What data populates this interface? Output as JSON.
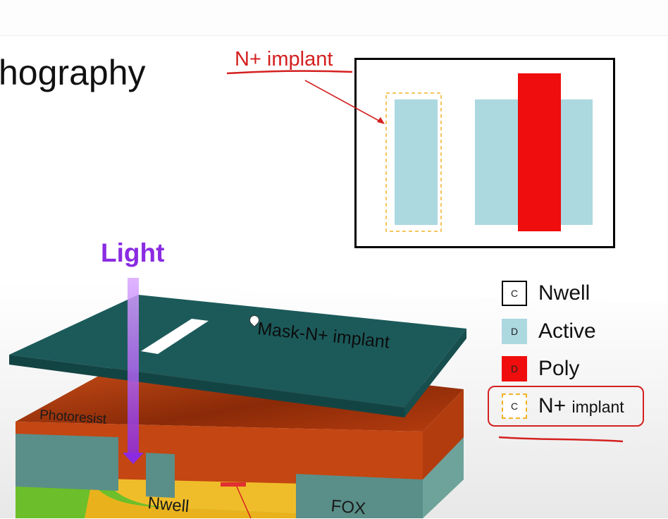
{
  "slide": {
    "title_fragment": "hography"
  },
  "annotation": {
    "label": "N+ implant",
    "color": "#d42020"
  },
  "layout": {
    "colors": {
      "active": "#acd8e0",
      "poly": "#ef0d0d",
      "implant_outline": "#f0b429"
    }
  },
  "diagram": {
    "light_label": "Light",
    "mask_label": "Mask-N+ implant",
    "photoresist_label": "Photoresist",
    "nwell_label": "Nwell",
    "fox_label": "FOX",
    "colors": {
      "mask": "#1c5a5a",
      "photoresist": "#c94a12",
      "nwell": "#e9b21c",
      "substrate": "#7ccf3a",
      "fox": "#5a8e88",
      "light": "#9b30ff"
    }
  },
  "legend": {
    "items": [
      {
        "swatch_text": "C",
        "label": "Nwell",
        "label_suffix": ""
      },
      {
        "swatch_text": "D",
        "label": "Active",
        "label_suffix": ""
      },
      {
        "swatch_text": "D",
        "label": "Poly",
        "label_suffix": ""
      },
      {
        "swatch_text": "C",
        "label": "N+",
        "label_suffix": "implant"
      }
    ]
  }
}
